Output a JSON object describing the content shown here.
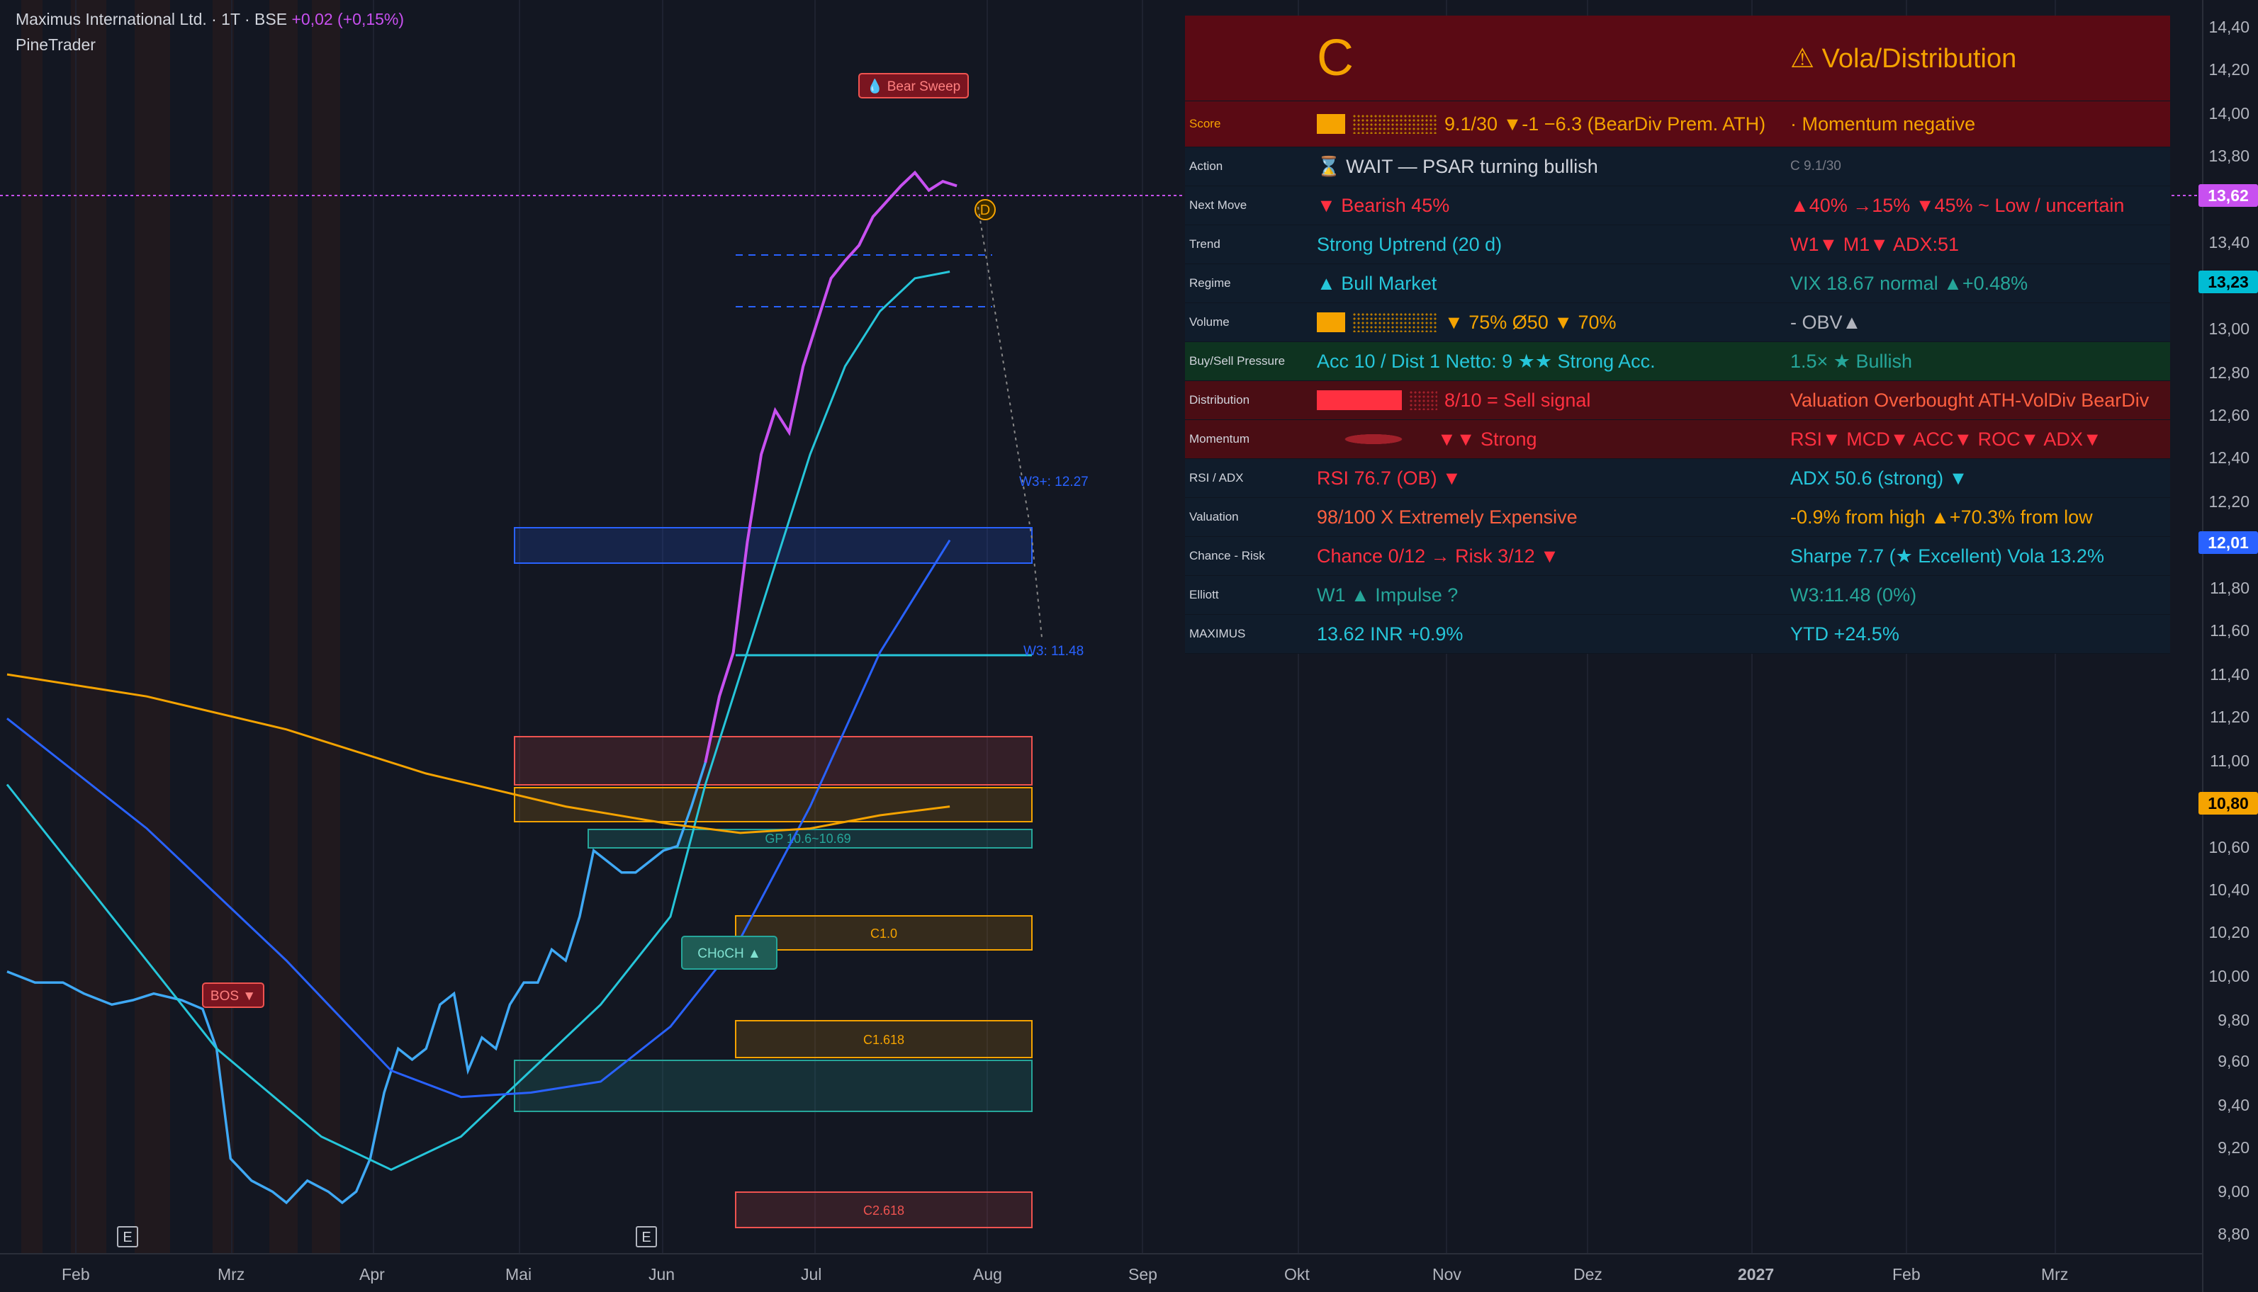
{
  "header": {
    "symbol": "Maximus International Ltd. · 1T · BSE",
    "change": "+0,02 (+0,15%)",
    "indicator": "PineTrader"
  },
  "chart_data": {
    "type": "line",
    "x_axis_labels": [
      "Feb",
      "Mrz",
      "Apr",
      "Mai",
      "Jun",
      "Jul",
      "Aug",
      "Sep",
      "Okt",
      "Nov",
      "Dez",
      "2027",
      "Feb",
      "Mrz"
    ],
    "y_axis_labels": [
      "14,40",
      "14,20",
      "14,00",
      "13,80",
      "13,40",
      "13,00",
      "12,80",
      "12,60",
      "12,40",
      "12,20",
      "11,80",
      "11,60",
      "11,40",
      "11,20",
      "11,00",
      "10,60",
      "10,40",
      "10,20",
      "10,00",
      "9,80",
      "9,60",
      "9,40",
      "9,20",
      "9,00",
      "8,80"
    ],
    "ylim": [
      8.8,
      14.4
    ],
    "price_tags": [
      {
        "value": "13,62",
        "color": "#c850f0"
      },
      {
        "value": "13,23",
        "color": "#00bcd4"
      },
      {
        "value": "12,01",
        "color": "#2962ff"
      },
      {
        "value": "10,80",
        "color": "#f5a300"
      }
    ],
    "series": [
      {
        "name": "Price",
        "color": "#3fa9f5",
        "points": [
          [
            0,
            10.05
          ],
          [
            8,
            10.0
          ],
          [
            16,
            10.0
          ],
          [
            22,
            9.95
          ],
          [
            30,
            9.9
          ],
          [
            36,
            9.92
          ],
          [
            42,
            9.95
          ],
          [
            50,
            9.92
          ],
          [
            56,
            9.88
          ],
          [
            60,
            9.7
          ],
          [
            64,
            9.2
          ],
          [
            70,
            9.1
          ],
          [
            76,
            9.05
          ],
          [
            80,
            9.0
          ],
          [
            86,
            9.1
          ],
          [
            92,
            9.05
          ],
          [
            96,
            9.0
          ],
          [
            100,
            9.05
          ],
          [
            104,
            9.2
          ],
          [
            108,
            9.5
          ],
          [
            112,
            9.7
          ],
          [
            116,
            9.65
          ],
          [
            120,
            9.7
          ],
          [
            124,
            9.9
          ],
          [
            128,
            9.95
          ],
          [
            132,
            9.6
          ],
          [
            136,
            9.75
          ],
          [
            140,
            9.7
          ],
          [
            144,
            9.9
          ],
          [
            148,
            10.0
          ],
          [
            152,
            10.0
          ],
          [
            156,
            10.15
          ],
          [
            160,
            10.1
          ],
          [
            164,
            10.3
          ],
          [
            168,
            10.6
          ],
          [
            172,
            10.55
          ],
          [
            176,
            10.5
          ],
          [
            180,
            10.5
          ],
          [
            184,
            10.55
          ],
          [
            188,
            10.6
          ],
          [
            192,
            10.62
          ],
          [
            196,
            10.8
          ],
          [
            200,
            11.0
          ],
          [
            204,
            11.3
          ],
          [
            208,
            11.5
          ],
          [
            212,
            12.0
          ],
          [
            216,
            12.4
          ],
          [
            220,
            12.6
          ],
          [
            224,
            12.5
          ],
          [
            228,
            12.8
          ],
          [
            232,
            13.0
          ],
          [
            236,
            13.2
          ],
          [
            240,
            13.28
          ],
          [
            244,
            13.35
          ],
          [
            248,
            13.48
          ],
          [
            252,
            13.55
          ],
          [
            256,
            13.62
          ],
          [
            260,
            13.68
          ],
          [
            264,
            13.6
          ],
          [
            268,
            13.64
          ],
          [
            272,
            13.62
          ]
        ]
      },
      {
        "name": "MA fast",
        "color": "#26c6da",
        "points": [
          [
            0,
            10.9
          ],
          [
            30,
            10.3
          ],
          [
            60,
            9.7
          ],
          [
            90,
            9.3
          ],
          [
            110,
            9.15
          ],
          [
            130,
            9.3
          ],
          [
            150,
            9.6
          ],
          [
            170,
            9.9
          ],
          [
            190,
            10.3
          ],
          [
            200,
            10.9
          ],
          [
            210,
            11.4
          ],
          [
            220,
            11.9
          ],
          [
            230,
            12.4
          ],
          [
            240,
            12.8
          ],
          [
            250,
            13.05
          ],
          [
            260,
            13.2
          ],
          [
            270,
            13.23
          ]
        ]
      },
      {
        "name": "MA mid",
        "color": "#2962ff",
        "points": [
          [
            0,
            11.2
          ],
          [
            40,
            10.7
          ],
          [
            80,
            10.1
          ],
          [
            110,
            9.6
          ],
          [
            130,
            9.48
          ],
          [
            150,
            9.5
          ],
          [
            170,
            9.55
          ],
          [
            190,
            9.8
          ],
          [
            210,
            10.2
          ],
          [
            230,
            10.8
          ],
          [
            250,
            11.5
          ],
          [
            270,
            12.01
          ]
        ]
      },
      {
        "name": "MA slow",
        "color": "#f5a300",
        "points": [
          [
            0,
            11.4
          ],
          [
            40,
            11.3
          ],
          [
            80,
            11.15
          ],
          [
            120,
            10.95
          ],
          [
            160,
            10.8
          ],
          [
            190,
            10.72
          ],
          [
            210,
            10.68
          ],
          [
            230,
            10.7
          ],
          [
            250,
            10.76
          ],
          [
            270,
            10.8
          ]
        ]
      }
    ],
    "zones": [
      {
        "label": "GP 10.6~10.69",
        "y0": 10.6,
        "y1": 10.69,
        "color": "#26a69a"
      },
      {
        "label": "C1.0",
        "y0": 10.2,
        "y1": 10.3,
        "color": "#f5a300"
      },
      {
        "label": "C1.618",
        "y0": 9.7,
        "y1": 9.8,
        "color": "#f5a300"
      },
      {
        "label": "C2.618",
        "y0": 8.9,
        "y1": 9.0,
        "color": "#ef5350"
      }
    ],
    "annotations": {
      "bear_sweep": "💧 Bear Sweep",
      "bos": "BOS ▼",
      "choch": "CHoCH ▲",
      "d_marker": "D",
      "w3plus": "W3+: 12.27",
      "w3": "W3: 11.48",
      "e_marker": "E"
    }
  },
  "panel": {
    "grade": "C",
    "headline": "⚠ Vola/Distribution",
    "rows": [
      {
        "label": "Score",
        "mid": "9.1/30 ▼-1  −6.3 (BearDiv Prem. ATH)",
        "right": "· Momentum negative"
      },
      {
        "label": "Action",
        "mid": "⌛ WAIT — PSAR turning bullish",
        "right": "C 9.1/30"
      },
      {
        "label": "Next Move",
        "mid": "▼ Bearish  45%",
        "right": "▲40% →15% ▼45%  ~  Low / uncertain"
      },
      {
        "label": "Trend",
        "mid": "Strong Uptrend (20 d)",
        "right": "W1▼ M1▼  ADX:51"
      },
      {
        "label": "Regime",
        "mid": "▲ Bull Market",
        "right": "VIX 18.67  normal  ▲+0.48%"
      },
      {
        "label": "Volume",
        "mid": "▼ 75% Ø50  ▼ 70%",
        "right": "-  OBV▲"
      },
      {
        "label": "Buy/Sell Pressure",
        "mid": "Acc 10 / Dist 1   Netto: 9   ★★ Strong Acc.",
        "right": "1.5×  ★  Bullish"
      },
      {
        "label": "Distribution",
        "mid": "8/10 =  Sell signal",
        "right": "Valuation Overbought ATH-VolDiv BearDiv"
      },
      {
        "label": "Momentum",
        "mid": "▼▼ Strong",
        "right": "RSI▼ MCD▼ ACC▼ ROC▼ ADX▼"
      },
      {
        "label": "RSI / ADX",
        "mid": "RSI 76.7 (OB)  ▼",
        "right": "ADX 50.6 (strong)  ▼"
      },
      {
        "label": "Valuation",
        "mid": "98/100  X  Extremely Expensive",
        "right": "-0.9% from high  ▲+70.3% from low"
      },
      {
        "label": "Chance - Risk",
        "mid": "Chance 0/12 →   Risk 3/12  ▼",
        "right": "Sharpe 7.7 (★ Excellent)   Vola 13.2%"
      },
      {
        "label": "Elliott",
        "mid": "W1 ▲ Impulse ?",
        "right": "W3:11.48 (0%)"
      },
      {
        "label": "MAXIMUS",
        "mid": "13.62 INR  +0.9%",
        "right": "YTD +24.5%"
      }
    ],
    "colors": {
      "header_bg": "#5a0a14",
      "score_bg": "#5a0a14",
      "row_bg": "#101c2b",
      "pressure_bg": "#0e3320",
      "dist_bg": "#4a0d14"
    }
  }
}
